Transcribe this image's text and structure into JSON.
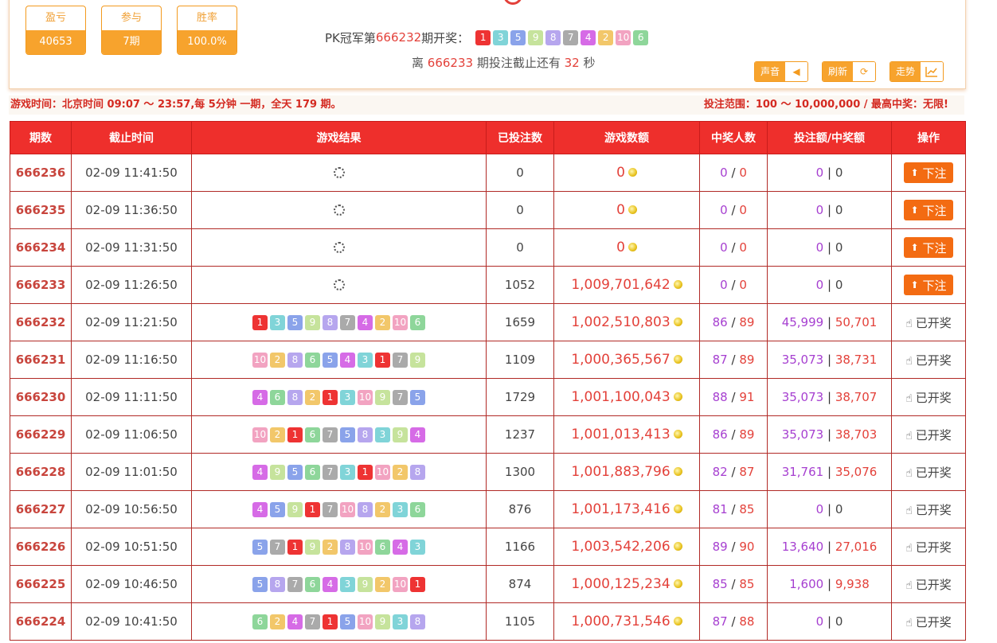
{
  "stats": [
    {
      "label": "盈亏",
      "value": "40653"
    },
    {
      "label": "参与",
      "value": "7期"
    },
    {
      "label": "胜率",
      "value": "100.0%"
    }
  ],
  "header": {
    "draw_prefix": "PK冠军第",
    "draw_issue": "666232",
    "draw_suffix": "期开奖：",
    "draw_balls": [
      1,
      3,
      5,
      9,
      8,
      7,
      4,
      2,
      10,
      6
    ],
    "countdown_prefix": "离",
    "countdown_issue": "666233",
    "countdown_middle": "期投注截止还有",
    "countdown_seconds": "32",
    "countdown_unit": "秒"
  },
  "toolbar": {
    "sound_label": "声音",
    "refresh_label": "刷新",
    "trend_label": "走势"
  },
  "info": {
    "left": "游戏时间：北京时间 09:07 ～ 23:57,每 5分钟 一期，全天 179 期。",
    "right": "投注范围：100 ～ 10,000,000 / 最高中奖：无限!"
  },
  "table": {
    "headers": [
      "期数",
      "截止时间",
      "游戏结果",
      "已投注数",
      "游戏数额",
      "中奖人数",
      "投注额/中奖额",
      "操作"
    ],
    "bet_label": "下注",
    "drawn_label": "已开奖",
    "rows": [
      {
        "issue": "666236",
        "time": "02-09 11:41:50",
        "balls": [],
        "bets": "0",
        "amount": "0",
        "win_a": "0",
        "win_b": "0",
        "bet_amt": "0",
        "win_amt": "0",
        "action": "bet"
      },
      {
        "issue": "666235",
        "time": "02-09 11:36:50",
        "balls": [],
        "bets": "0",
        "amount": "0",
        "win_a": "0",
        "win_b": "0",
        "bet_amt": "0",
        "win_amt": "0",
        "action": "bet"
      },
      {
        "issue": "666234",
        "time": "02-09 11:31:50",
        "balls": [],
        "bets": "0",
        "amount": "0",
        "win_a": "0",
        "win_b": "0",
        "bet_amt": "0",
        "win_amt": "0",
        "action": "bet"
      },
      {
        "issue": "666233",
        "time": "02-09 11:26:50",
        "balls": [],
        "bets": "1052",
        "amount": "1,009,701,642",
        "win_a": "0",
        "win_b": "0",
        "bet_amt": "0",
        "win_amt": "0",
        "action": "bet"
      },
      {
        "issue": "666232",
        "time": "02-09 11:21:50",
        "balls": [
          1,
          3,
          5,
          9,
          8,
          7,
          4,
          2,
          10,
          6
        ],
        "bets": "1659",
        "amount": "1,002,510,803",
        "win_a": "86",
        "win_b": "89",
        "bet_amt": "45,999",
        "win_amt": "50,701",
        "action": "drawn"
      },
      {
        "issue": "666231",
        "time": "02-09 11:16:50",
        "balls": [
          10,
          2,
          8,
          6,
          5,
          4,
          3,
          1,
          7,
          9
        ],
        "bets": "1109",
        "amount": "1,000,365,567",
        "win_a": "87",
        "win_b": "89",
        "bet_amt": "35,073",
        "win_amt": "38,731",
        "action": "drawn"
      },
      {
        "issue": "666230",
        "time": "02-09 11:11:50",
        "balls": [
          4,
          6,
          8,
          2,
          1,
          3,
          10,
          9,
          7,
          5
        ],
        "bets": "1729",
        "amount": "1,001,100,043",
        "win_a": "88",
        "win_b": "91",
        "bet_amt": "35,073",
        "win_amt": "38,707",
        "action": "drawn"
      },
      {
        "issue": "666229",
        "time": "02-09 11:06:50",
        "balls": [
          10,
          2,
          1,
          6,
          7,
          5,
          8,
          3,
          9,
          4
        ],
        "bets": "1237",
        "amount": "1,001,013,413",
        "win_a": "86",
        "win_b": "89",
        "bet_amt": "35,073",
        "win_amt": "38,703",
        "action": "drawn"
      },
      {
        "issue": "666228",
        "time": "02-09 11:01:50",
        "balls": [
          4,
          9,
          5,
          6,
          7,
          3,
          1,
          10,
          2,
          8
        ],
        "bets": "1300",
        "amount": "1,001,883,796",
        "win_a": "82",
        "win_b": "87",
        "bet_amt": "31,761",
        "win_amt": "35,076",
        "action": "drawn"
      },
      {
        "issue": "666227",
        "time": "02-09 10:56:50",
        "balls": [
          4,
          5,
          9,
          1,
          7,
          10,
          8,
          2,
          3,
          6
        ],
        "bets": "876",
        "amount": "1,001,173,416",
        "win_a": "81",
        "win_b": "85",
        "bet_amt": "0",
        "win_amt": "0",
        "action": "drawn"
      },
      {
        "issue": "666226",
        "time": "02-09 10:51:50",
        "balls": [
          5,
          7,
          1,
          9,
          2,
          8,
          10,
          6,
          4,
          3
        ],
        "bets": "1166",
        "amount": "1,003,542,206",
        "win_a": "89",
        "win_b": "90",
        "bet_amt": "13,640",
        "win_amt": "27,016",
        "action": "drawn"
      },
      {
        "issue": "666225",
        "time": "02-09 10:46:50",
        "balls": [
          5,
          8,
          7,
          6,
          4,
          3,
          9,
          2,
          10,
          1
        ],
        "bets": "874",
        "amount": "1,000,125,234",
        "win_a": "85",
        "win_b": "85",
        "bet_amt": "1,600",
        "win_amt": "9,938",
        "action": "drawn"
      },
      {
        "issue": "666224",
        "time": "02-09 10:41:50",
        "balls": [
          6,
          2,
          4,
          7,
          1,
          5,
          10,
          9,
          3,
          8
        ],
        "bets": "1105",
        "amount": "1,000,731,546",
        "win_a": "87",
        "win_b": "88",
        "bet_amt": "0",
        "win_amt": "0",
        "action": "drawn"
      }
    ]
  },
  "ball_colors": {
    "1": "#ee3333",
    "2": "#f2c76a",
    "3": "#80d4d8",
    "4": "#d66be6",
    "5": "#8aa3ea",
    "6": "#8ed69a",
    "7": "#aaaaaa",
    "8": "#b6a6ee",
    "9": "#c6e39c",
    "10": "#f2a3c1"
  }
}
